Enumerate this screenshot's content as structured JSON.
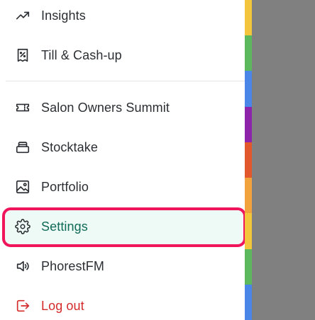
{
  "menu": {
    "items": [
      {
        "key": "insights",
        "label": "Insights",
        "icon": "trending-up-icon"
      },
      {
        "key": "till",
        "label": "Till & Cash-up",
        "icon": "receipt-percent-icon"
      },
      {
        "key": "summit",
        "label": "Salon Owners Summit",
        "icon": "ticket-icon"
      },
      {
        "key": "stocktake",
        "label": "Stocktake",
        "icon": "stock-box-icon"
      },
      {
        "key": "portfolio",
        "label": "Portfolio",
        "icon": "image-icon"
      },
      {
        "key": "settings",
        "label": "Settings",
        "icon": "gear-icon",
        "active": true
      },
      {
        "key": "phorestfm",
        "label": "PhorestFM",
        "icon": "speaker-icon"
      },
      {
        "key": "logout",
        "label": "Log out",
        "icon": "logout-icon"
      }
    ]
  },
  "colors": {
    "text": "#2b2f33",
    "active_text": "#0f6b57",
    "active_bg": "#eefaf6",
    "highlight_ring": "#f0155b",
    "logout_text": "#d42a2a",
    "backdrop": "#808080"
  },
  "stripes": [
    "#f2c53d",
    "#5cb85c",
    "#4a86e8",
    "#8e24aa",
    "#e2572b",
    "#f2a23d",
    "#f2c53d",
    "#5cb85c",
    "#4a86e8"
  ]
}
